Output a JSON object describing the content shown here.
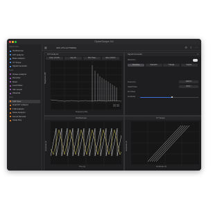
{
  "window": {
    "title": "OpenScope X4"
  },
  "sidebar": {
    "section_main": "Signal Input",
    "items": [
      {
        "label": "Oscilloscope",
        "color": "#4a90e2"
      },
      {
        "label": "FFT analyzer",
        "color": "#4a90e2"
      },
      {
        "label": "Bode analyzer",
        "color": "#4a90e2"
      },
      {
        "label": "XY Scope",
        "color": "#4a90e2"
      },
      {
        "label": "Signal Generator",
        "color": "#4a90e2"
      }
    ],
    "section_tools": "Tools",
    "tools": [
      {
        "label": "Octave analyzer",
        "color": "#9b59b6"
      },
      {
        "label": "Recorder",
        "color": "#9b59b6"
      },
      {
        "label": "Meter",
        "color": "#9b59b6"
      },
      {
        "label": "Level Meter",
        "color": "#9b59b6"
      },
      {
        "label": "Vibr Levels",
        "color": "#9b59b6"
      },
      {
        "label": "Waterfall",
        "color": "#9b59b6"
      }
    ],
    "section_view": "View",
    "views": [
      {
        "label": "Split View",
        "color": "#e67e22",
        "selected": true
      },
      {
        "label": "Dual FFT analyzer",
        "color": "#e67e22"
      },
      {
        "label": "THD analysis",
        "color": "#e67e22"
      },
      {
        "label": "Noise Analyzer",
        "color": "#e67e22"
      },
      {
        "label": "Sound Records",
        "color": "#e67e22"
      },
      {
        "label": "Scale Poly",
        "color": "#e67e22"
      }
    ]
  },
  "toolbar": {
    "device": "ADC-2 Pro (A7700001)",
    "run_label": "Split View"
  },
  "fft_panel": {
    "title": "FFT Analyzer",
    "controls": [
      "Freq: 1.0 kHz",
      "Avg: 16",
      "Win: Hann",
      "Res: 2.93 Hz"
    ],
    "ylabel": "Magnitude (dB)",
    "xlabel": "Frequency (Hz)"
  },
  "signal_panel": {
    "title": "Signal Generator",
    "waveform_label": "Waveform",
    "tabs": [
      "Sinewave",
      "Sawtooth",
      "Triangle",
      "Square"
    ],
    "freq_label": "Frequency",
    "freq_value": "1000 Hz",
    "phase_label": "Initial Phase",
    "phase_value": "180.0 °",
    "dc_label": "DC Offset",
    "amp_label": "Amplitude",
    "amp_level": 0.55,
    "toggle_on": true
  },
  "osc_panel": {
    "title": "Oscilloscope",
    "xlabel": "Time (s)",
    "ylabel": "Amplitude (V)"
  },
  "xy_panel": {
    "title": "XY Scope",
    "xlabel": "Amplitude (V)",
    "ylabel": "Amplitude (V)"
  }
}
